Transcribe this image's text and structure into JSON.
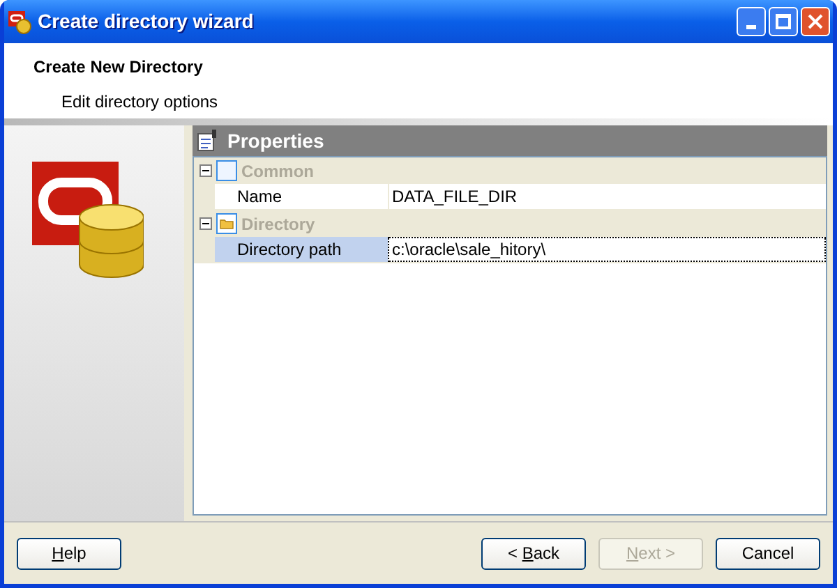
{
  "window": {
    "title": "Create directory wizard"
  },
  "header": {
    "title": "Create New Directory",
    "subtitle": "Edit directory options"
  },
  "properties": {
    "title": "Properties",
    "groups": [
      {
        "name": "Common",
        "kind": "blank",
        "expanded": true,
        "rows": [
          {
            "label": "Name",
            "value": "DATA_FILE_DIR",
            "selected": false
          }
        ]
      },
      {
        "name": "Directory",
        "kind": "folder",
        "expanded": true,
        "rows": [
          {
            "label": "Directory path",
            "value": "c:\\oracle\\sale_hitory\\",
            "selected": true
          }
        ]
      }
    ]
  },
  "help_button": {
    "key": "H",
    "post": "elp",
    "disabled": false
  },
  "nav_buttons": [
    {
      "pre": "< ",
      "key": "B",
      "post": "ack",
      "disabled": false
    },
    {
      "key": "N",
      "post": "ext >",
      "disabled": true
    },
    {
      "pre": "Cancel",
      "disabled": false
    }
  ]
}
